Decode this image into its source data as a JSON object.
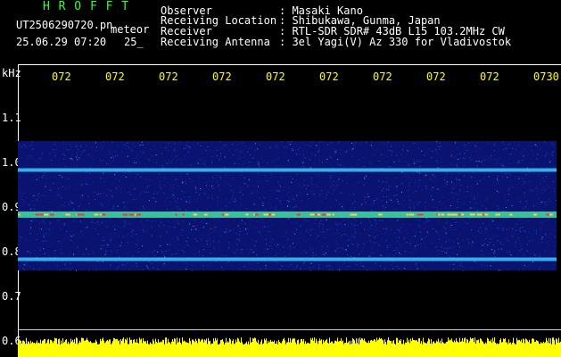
{
  "header": {
    "logo": "H R O F F T",
    "filename": "UT2506290720.pn",
    "mode": "meteor",
    "datetime": "25.06.29 07:20",
    "scale_value": "25_",
    "info": [
      {
        "label": "Observer",
        "value": ": Masaki Kano"
      },
      {
        "label": "Receiving Location",
        "value": ": Shibukawa, Gunma, Japan"
      },
      {
        "label": "Receiver",
        "value": ": RTL-SDR SDR# 43dB L15 103.2MHz CW"
      },
      {
        "label": "Receiving Antenna",
        "value": ": 3el Yagi(V) Az 330 for Vladivostok"
      }
    ]
  },
  "axes": {
    "y_unit": "kHz",
    "y_ticks": [
      "1.1",
      "1.0",
      "0.9",
      "0.8",
      "0.7",
      "0.6"
    ],
    "x_ticks": [
      "072",
      "072",
      "072",
      "072",
      "072",
      "072",
      "072",
      "072",
      "072",
      "0730"
    ]
  },
  "chart_data": {
    "type": "heatmap",
    "xlabel": "",
    "ylabel": "kHz",
    "xlim": [
      "0720",
      "0730"
    ],
    "ylim": [
      0.6,
      1.15
    ],
    "bands": [
      {
        "freq_khz": 0.985,
        "intensity": "medium"
      },
      {
        "freq_khz": 0.885,
        "intensity": "high"
      },
      {
        "freq_khz": 0.785,
        "intensity": "medium-high"
      }
    ],
    "noise_floor_region_khz": [
      0.76,
      1.05
    ],
    "colors": {
      "background": "#000000",
      "noise": "#1020b0",
      "band": "#30e0ff",
      "peak": "#ff3030",
      "bottom_trace": "#ffff00"
    }
  }
}
